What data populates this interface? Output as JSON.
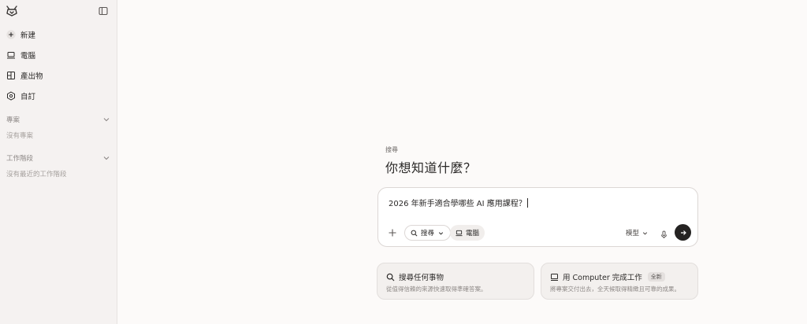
{
  "sidebar": {
    "nav": [
      {
        "label": "新建",
        "icon": "plus-icon"
      },
      {
        "label": "電腦",
        "icon": "laptop-icon"
      },
      {
        "label": "產出物",
        "icon": "artifacts-icon"
      },
      {
        "label": "自訂",
        "icon": "customize-icon"
      }
    ],
    "sections": [
      {
        "title": "專案",
        "empty": "沒有專案"
      },
      {
        "title": "工作階段",
        "empty": "沒有最近的工作階段"
      }
    ]
  },
  "main": {
    "eyebrow": "搜尋",
    "headline": "你想知道什麼？",
    "composer": {
      "text": "2026 年新手適合學哪些 AI 應用課程？",
      "search_chip": "搜尋",
      "computer_chip": "電腦",
      "model_label": "模型"
    },
    "cards": [
      {
        "title": "搜尋任何事物",
        "desc": "從值得信賴的來源快速取得準確答案。",
        "icon": "search-icon"
      },
      {
        "title": "用 Computer 完成工作",
        "badge": "全新",
        "desc": "將專案交付出去，全天候取得精緻且可靠的成果。",
        "icon": "computer-icon"
      }
    ]
  },
  "colors": {
    "background": "#fcfaf9",
    "sidebar": "#f5f2f1",
    "send_button": "#252322"
  }
}
